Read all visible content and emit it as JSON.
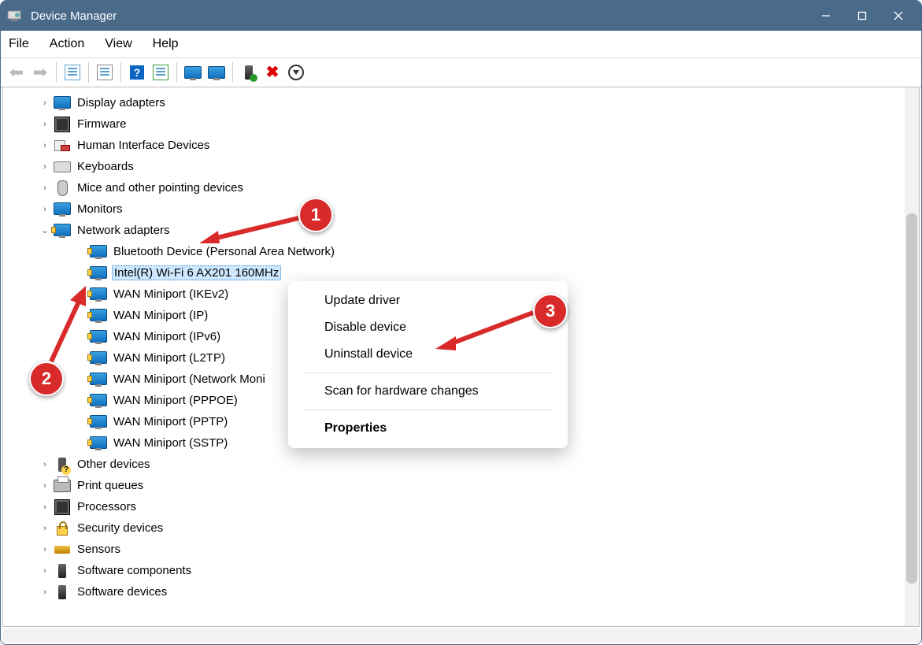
{
  "window": {
    "title": "Device Manager"
  },
  "menu": {
    "file": "File",
    "action": "Action",
    "view": "View",
    "help": "Help"
  },
  "tree": {
    "categories": [
      {
        "label": "Display adapters",
        "icon": "ic-monitor",
        "expanded": false
      },
      {
        "label": "Firmware",
        "icon": "ic-chip",
        "expanded": false
      },
      {
        "label": "Human Interface Devices",
        "icon": "ic-hid",
        "expanded": false
      },
      {
        "label": "Keyboards",
        "icon": "ic-kb",
        "expanded": false
      },
      {
        "label": "Mice and other pointing devices",
        "icon": "ic-mouse",
        "expanded": false
      },
      {
        "label": "Monitors",
        "icon": "ic-monitor",
        "expanded": false
      },
      {
        "label": "Network adapters",
        "icon": "ic-adapter",
        "expanded": true,
        "children": [
          {
            "label": "Bluetooth Device (Personal Area Network)",
            "selected": false
          },
          {
            "label": "Intel(R) Wi-Fi 6 AX201 160MHz",
            "selected": true
          },
          {
            "label": "WAN Miniport (IKEv2)",
            "selected": false
          },
          {
            "label": "WAN Miniport (IP)",
            "selected": false
          },
          {
            "label": "WAN Miniport (IPv6)",
            "selected": false
          },
          {
            "label": "WAN Miniport (L2TP)",
            "selected": false
          },
          {
            "label": "WAN Miniport (Network Moni",
            "selected": false
          },
          {
            "label": "WAN Miniport (PPPOE)",
            "selected": false
          },
          {
            "label": "WAN Miniport (PPTP)",
            "selected": false
          },
          {
            "label": "WAN Miniport (SSTP)",
            "selected": false
          }
        ]
      },
      {
        "label": "Other devices",
        "icon": "ic-other",
        "expanded": false
      },
      {
        "label": "Print queues",
        "icon": "ic-printer",
        "expanded": false
      },
      {
        "label": "Processors",
        "icon": "ic-chip",
        "expanded": false
      },
      {
        "label": "Security devices",
        "icon": "ic-lock",
        "expanded": false
      },
      {
        "label": "Sensors",
        "icon": "ic-sensor",
        "expanded": false
      },
      {
        "label": "Software components",
        "icon": "ic-sw",
        "expanded": false
      },
      {
        "label": "Software devices",
        "icon": "ic-sw",
        "expanded": false
      }
    ]
  },
  "context_menu": {
    "items": [
      {
        "label": "Update driver",
        "bold": false,
        "divider_after": false
      },
      {
        "label": "Disable device",
        "bold": false,
        "divider_after": false
      },
      {
        "label": "Uninstall device",
        "bold": false,
        "divider_after": true
      },
      {
        "label": "Scan for hardware changes",
        "bold": false,
        "divider_after": true
      },
      {
        "label": "Properties",
        "bold": true,
        "divider_after": false
      }
    ]
  },
  "annotations": {
    "b1": "1",
    "b2": "2",
    "b3": "3"
  }
}
